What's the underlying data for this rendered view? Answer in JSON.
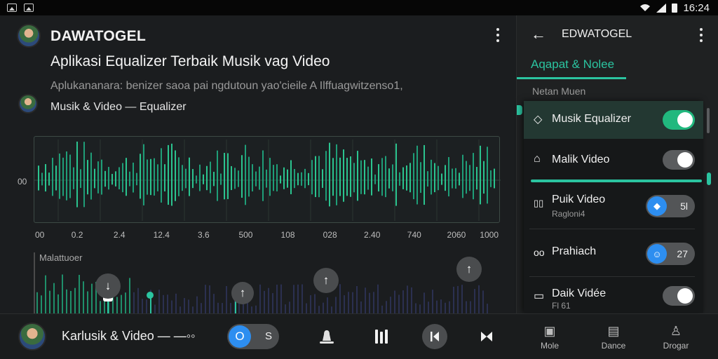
{
  "status_bar": {
    "time": "16:24"
  },
  "header": {
    "app_title": "DAWATOGEL",
    "headline": "Aplikasi Equalizer Terbaik Musik vag Video",
    "subline": "Aplukananara: benizer saoa pai ngdutoun yao'cieile A Ilffuagwitzenso1,",
    "channel": "Musik & Video — Equalizer"
  },
  "waveform": {
    "y_label": "00",
    "x_ticks": [
      "00",
      "0.2",
      "2.4",
      "12.4",
      "3.6",
      "500",
      "108",
      "028",
      "2.40",
      "740",
      "2060",
      "1000"
    ]
  },
  "lower_chart": {
    "label": "Malattuoer",
    "markers": [
      "↓",
      "↑",
      "↑",
      "↑"
    ]
  },
  "side_panel": {
    "title": "EDWATOGEL",
    "active_tab": "Aqapat & Nolee",
    "section_label": "Netan Muen",
    "rows": [
      {
        "icon": "◇",
        "label": "Musik Equalizer",
        "state": "on"
      },
      {
        "icon": "⌂",
        "label": "Malik Video",
        "state": "off"
      },
      {
        "icon": "▯▯",
        "label": "Puik Video",
        "sub": "Ragloni4",
        "value": "5l"
      },
      {
        "icon": "oo",
        "label": "Prahiach",
        "value": "27"
      },
      {
        "icon": "▭",
        "label": "Daik Vidée",
        "sub": "Fl 61",
        "state": "off"
      }
    ]
  },
  "bottom_bar": {
    "now_playing": "Karlusik & Video — —◦◦",
    "pill_primary": "O",
    "pill_secondary": "S",
    "nav": [
      {
        "icon": "▣",
        "label": "Mole"
      },
      {
        "icon": "▤",
        "label": "Dance"
      },
      {
        "icon": "♙",
        "label": "Drogar"
      }
    ]
  },
  "colors": {
    "accent": "#2bc4a0",
    "toggle_on": "#21b87e",
    "blue": "#2d8ef0",
    "background": "#1b1d1f"
  }
}
